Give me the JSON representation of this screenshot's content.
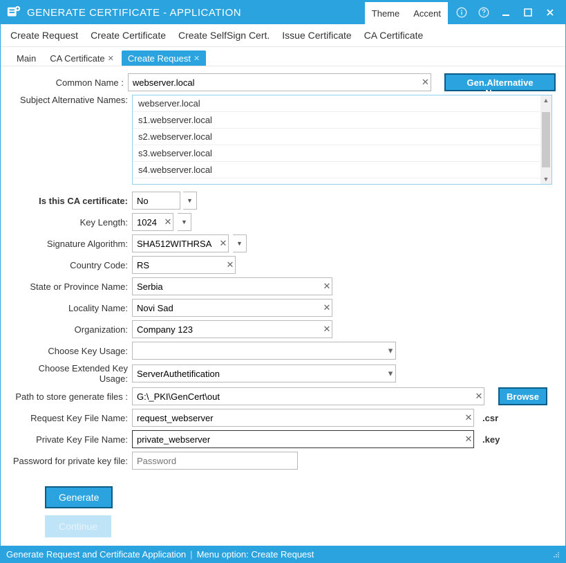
{
  "window": {
    "title": "GENERATE CERTIFICATE - APPLICATION"
  },
  "theme_menu": {
    "theme": "Theme",
    "accent": "Accent"
  },
  "menubar": {
    "items": [
      "Create Request",
      "Create Certificate",
      "Create SelfSign Cert.",
      "Issue Certificate",
      "CA Certificate"
    ]
  },
  "tabs": {
    "items": [
      {
        "label": "Main",
        "closable": false
      },
      {
        "label": "CA Certificate",
        "closable": true
      },
      {
        "label": "Create Request",
        "closable": true,
        "active": true
      }
    ]
  },
  "labels": {
    "common_name": "Common Name :",
    "san": "Subject Alternative Names:",
    "is_ca": "Is this CA certificate:",
    "key_length": "Key Length:",
    "sig_alg": "Signature Algorithm:",
    "country": "Country Code:",
    "state": "State or Province Name:",
    "locality": "Locality Name:",
    "org": "Organization:",
    "key_usage": "Choose Key Usage:",
    "ext_key_usage": "Choose Extended Key Usage:",
    "path": "Path to store generate files :",
    "req_file": "Request Key File Name:",
    "priv_file": "Private Key File Name:",
    "password": "Password for private key file:"
  },
  "values": {
    "common_name": "webserver.local",
    "san_list": [
      "webserver.local",
      "s1.webserver.local",
      "s2.webserver.local",
      "s3.webserver.local",
      "s4.webserver.local"
    ],
    "is_ca": "No",
    "key_length": "1024",
    "sig_alg": "SHA512WITHRSA",
    "country": "RS",
    "state": "Serbia",
    "locality": "Novi Sad",
    "org": "Company 123",
    "key_usage": "",
    "ext_key_usage": "ServerAuthetification",
    "path": "G:\\_PKI\\GenCert\\out",
    "req_file": "request_webserver",
    "priv_file": "private_webserver",
    "password_placeholder": "Password"
  },
  "suffix": {
    "csr": ".csr",
    "key": ".key"
  },
  "buttons": {
    "gen_alt_names": "Gen.Alternative Names",
    "browse": "Browse",
    "generate": "Generate",
    "continue": "Continue"
  },
  "statusbar": {
    "left": "Generate Request and Certificate Application",
    "right": "Menu option:  Create Request"
  }
}
